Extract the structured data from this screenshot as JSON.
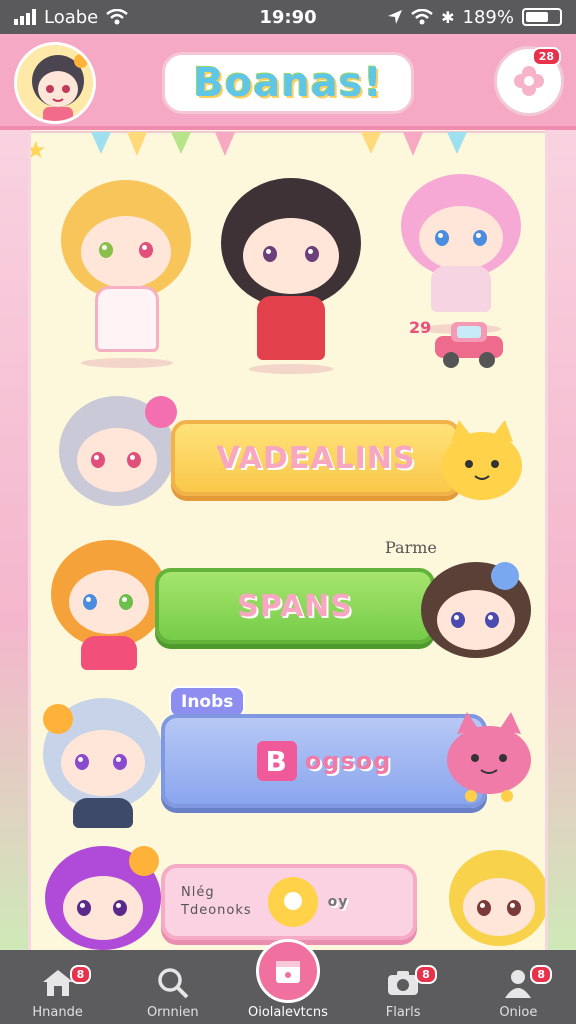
{
  "status": {
    "carrier": "Loabe",
    "time": "19:90",
    "battery": "189%"
  },
  "header": {
    "title": "Boanas!",
    "notify_badge": "28"
  },
  "main": {
    "buttons": [
      {
        "label": "VADEALINS"
      },
      {
        "label": "SPANS"
      },
      {
        "label": "ogsog"
      },
      {
        "label": "oy"
      }
    ],
    "top_badge": "29",
    "tag_parme": "Parme",
    "tag_inobs": "Inobs",
    "b_letter": "B",
    "card_line1": "Nlég",
    "card_line2": "Tdeonoks"
  },
  "nav": {
    "items": [
      {
        "label": "Hnande",
        "badge": "8"
      },
      {
        "label": "Ornnien"
      },
      {
        "label": "Oiolalevtcns"
      },
      {
        "label": "Flarls",
        "badge": "8"
      },
      {
        "label": "Onioe",
        "badge": "8"
      }
    ]
  },
  "colors": {
    "accent": "#f070a0",
    "header": "#f6a9c4",
    "panel": "#fdf7dc"
  }
}
